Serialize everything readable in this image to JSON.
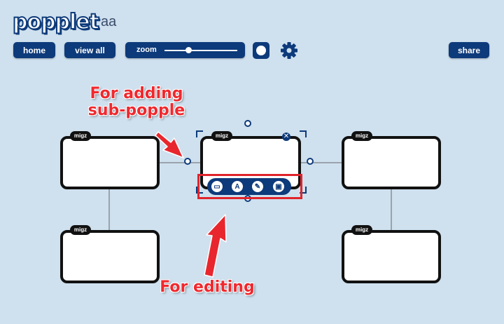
{
  "header": {
    "logo_text": "popplet",
    "board_title": "aa",
    "home_label": "home",
    "view_all_label": "view all",
    "zoom_label": "zoom",
    "zoom_level": 0.33,
    "share_label": "share"
  },
  "popples": [
    {
      "tag": "migz"
    },
    {
      "tag": "migz"
    },
    {
      "tag": "migz"
    },
    {
      "tag": "migz"
    },
    {
      "tag": "migz"
    }
  ],
  "edit_toolbar": {
    "tools": [
      {
        "icon": "frame-icon",
        "glyph": "▭"
      },
      {
        "icon": "text-icon",
        "glyph": "A"
      },
      {
        "icon": "pencil-icon",
        "glyph": "✎"
      },
      {
        "icon": "image-icon",
        "glyph": "▣"
      }
    ]
  },
  "annotations": {
    "add_subpopple": "For adding\nsub-popple",
    "editing": "For editing"
  },
  "colors": {
    "background": "#cfe0ee",
    "brand": "#0d3a7a",
    "annotation": "#f0282e"
  }
}
